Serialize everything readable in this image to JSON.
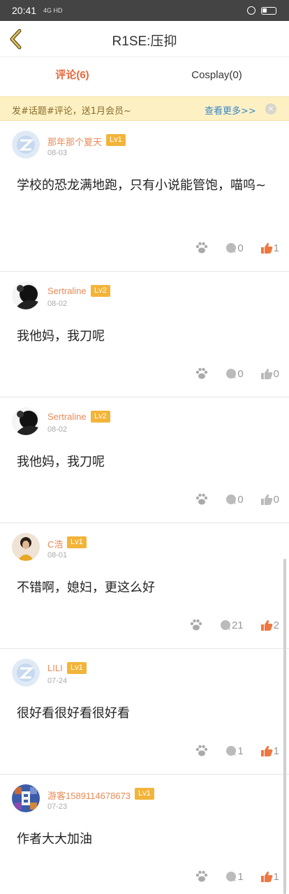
{
  "status_bar": {
    "time": "20:41",
    "signal": "4G HD"
  },
  "nav": {
    "title": "R1SE:压抑",
    "back_icon": "back-chevron-icon"
  },
  "tabs": [
    {
      "label": "评论(6)",
      "active": true
    },
    {
      "label": "Cosplay(0)",
      "active": false
    }
  ],
  "banner": {
    "text": "发#话题#评论，送1月会员~",
    "link": "查看更多>>",
    "close": "×"
  },
  "colors": {
    "accent": "#e8663a",
    "level_badge": "#f3b43a",
    "username": "#e98a55",
    "like_active": "#f07840",
    "banner_bg": "#fdf1c4",
    "link": "#3b86c9"
  },
  "comments": [
    {
      "user": "那年那个夏天",
      "level": "Lv1",
      "date": "08-03",
      "text": "学校的恐龙满地跑，只有小说能管饱，喵呜~",
      "avatar": "default-avatar",
      "replies": "0",
      "likes": "1",
      "liked": true
    },
    {
      "user": "Sertraline",
      "level": "Lv2",
      "date": "08-02",
      "text": "我他妈，我刀呢",
      "avatar": "dark-avatar",
      "replies": "0",
      "likes": "0",
      "liked": false
    },
    {
      "user": "Sertraline",
      "level": "Lv2",
      "date": "08-02",
      "text": "我他妈，我刀呢",
      "avatar": "dark-avatar",
      "replies": "0",
      "likes": "0",
      "liked": false
    },
    {
      "user": "C浩",
      "level": "Lv1",
      "date": "08-01",
      "text": "不错啊，媳妇，更这么好",
      "avatar": "photo-avatar",
      "replies": "21",
      "likes": "2",
      "liked": true
    },
    {
      "user": "LILI",
      "level": "Lv1",
      "date": "07-24",
      "text": "很好看很好看很好看",
      "avatar": "default-avatar",
      "replies": "1",
      "likes": "1",
      "liked": true
    },
    {
      "user": "游客1589114678673",
      "level": "Lv1",
      "date": "07-23",
      "text": "作者大大加油",
      "avatar": "pixel-avatar",
      "replies": "1",
      "likes": "1",
      "liked": true
    }
  ]
}
